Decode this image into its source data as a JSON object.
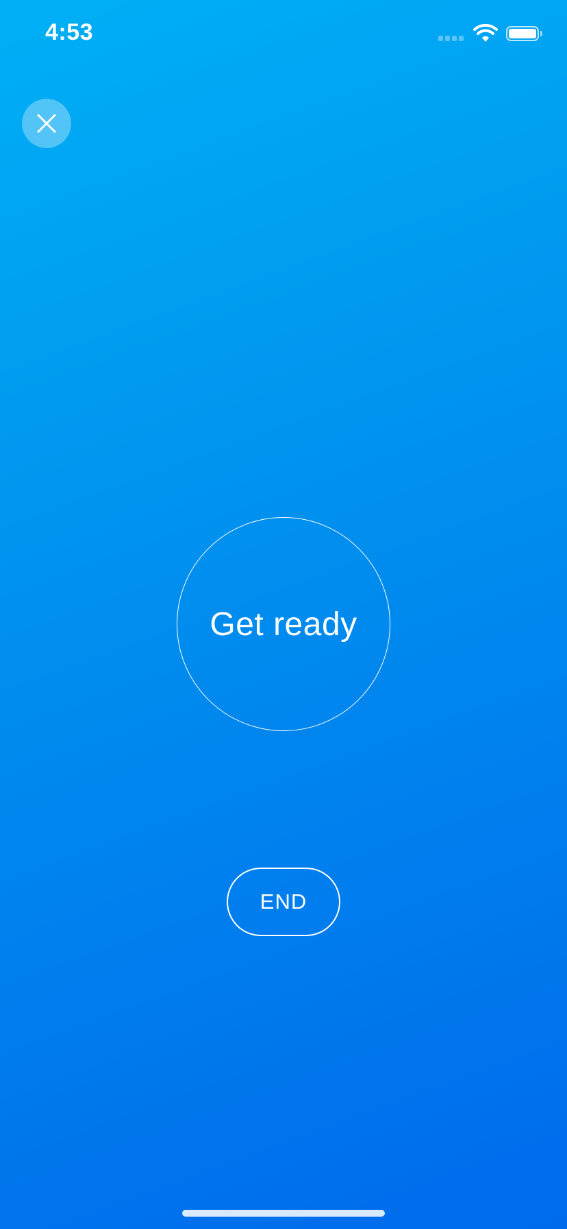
{
  "status_bar": {
    "time": "4:53",
    "signal_icon": "cellular-signal-icon",
    "wifi_icon": "wifi-icon",
    "battery_icon": "battery-icon",
    "battery_level": 1.0
  },
  "header": {
    "close_icon": "close-icon"
  },
  "main": {
    "prompt_text": "Get ready"
  },
  "controls": {
    "end_label": "END"
  },
  "colors": {
    "gradient_top": "#00b0f6",
    "gradient_bottom": "#006aec",
    "foreground": "#ffffff"
  }
}
